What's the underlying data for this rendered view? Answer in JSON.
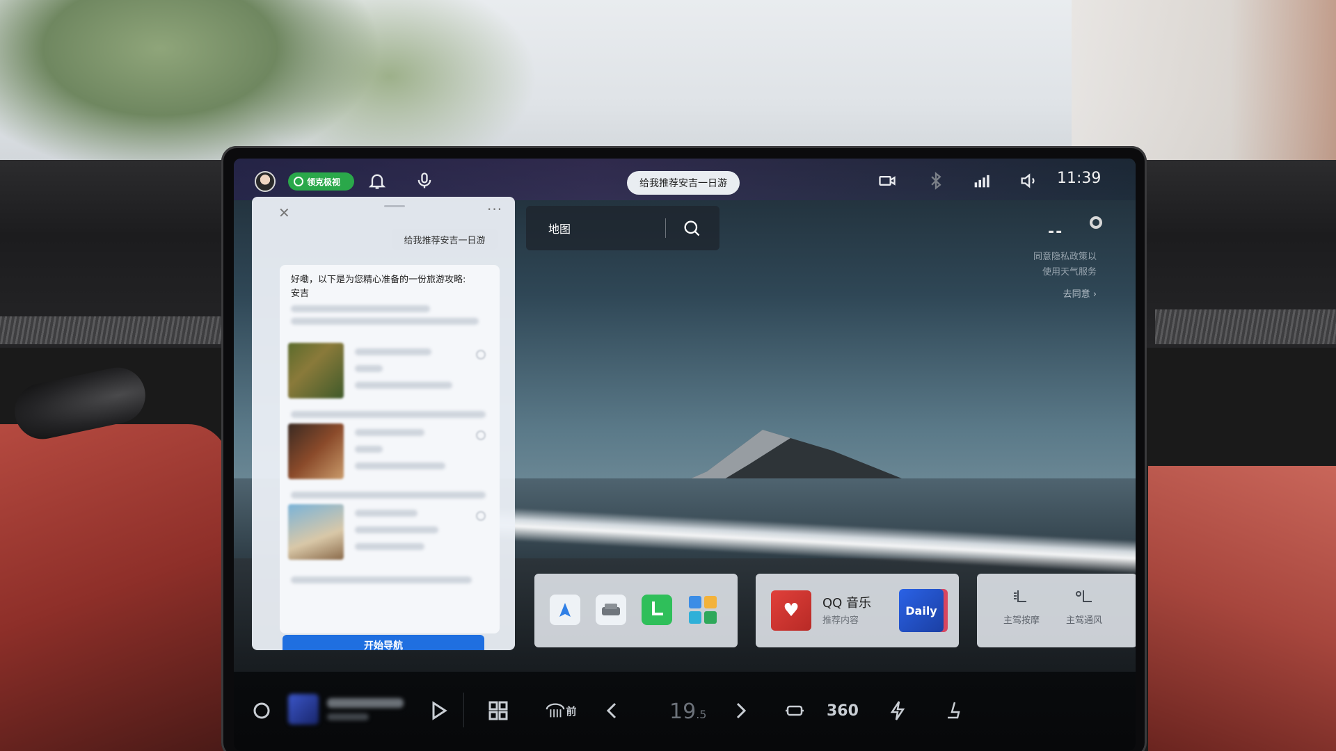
{
  "status_bar": {
    "brand_label": "领克极视",
    "voice_suggestion": "给我推荐安吉一日游",
    "time": "11:39",
    "icons": [
      "avatar",
      "bell-icon",
      "mic-icon",
      "camera-icon",
      "bluetooth-icon",
      "5g-signal-icon",
      "volume-icon"
    ]
  },
  "chat": {
    "user_message": "给我推荐安吉一日游",
    "answer_intro": "好嘞，以下是为您精心准备的一份旅游攻略:",
    "answer_place": "安吉",
    "nav_button_label": "开始导航",
    "close_glyph": "✕",
    "more_glyph": "···"
  },
  "map_search": {
    "label": "地图"
  },
  "weather": {
    "placeholder": "--",
    "privacy_line1": "同意隐私政策以",
    "privacy_line2": "使用天气服务",
    "agree_link": "去同意 ›"
  },
  "dock": {
    "music": {
      "title": "QQ 音乐",
      "subtitle": "推荐内容",
      "tile_label": "Daily"
    },
    "seat": {
      "massage_label": "主驾按摩",
      "ventilation_label": "主驾通风",
      "more_glyph": "··"
    }
  },
  "bottom_bar": {
    "defrost_label": "前",
    "temperature": "19",
    "temperature_fraction": ".5",
    "camera360_label": "360"
  },
  "colors": {
    "brand_green": "#2aa84a",
    "nav_blue": "#1f6fe0",
    "music_red": "#e0403a",
    "daily_blue": "#2a62e6"
  }
}
